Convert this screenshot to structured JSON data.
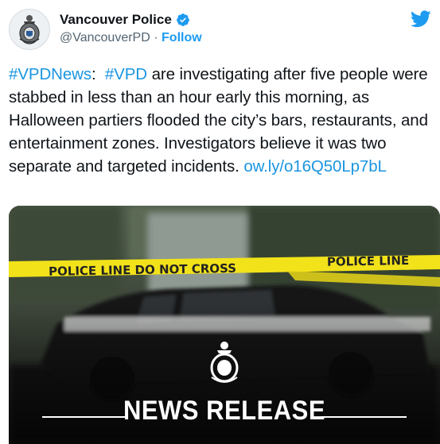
{
  "account": {
    "name": "Vancouver Police",
    "handle": "@VancouverPD",
    "separator": "·",
    "follow_label": "Follow"
  },
  "tweet": {
    "hashtag1": "#VPDNews",
    "colon": ":",
    "hashtag2": "#VPD",
    "body": " are investigating after five people were stabbed in less than an hour early this morning, as Halloween partiers flooded the city’s bars, restaurants, and entertainment zones. Investigators believe it was two separate and targeted incidents.",
    "link": "ow.ly/o16Q50Lp7bL"
  },
  "media": {
    "banner_text": "NEWS RELEASE"
  },
  "icons": {
    "verified": "verified-badge-icon",
    "platform": "twitter-bird-icon",
    "crest": "police-crest-icon"
  },
  "colors": {
    "accent": "#1d9bf0",
    "link": "#1b95e0",
    "tape": "#f2e21a",
    "text": "#0f1419",
    "muted": "#536471"
  }
}
